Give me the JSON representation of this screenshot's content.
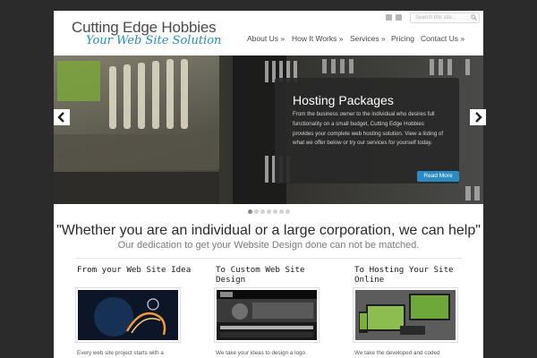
{
  "header": {
    "title": "Cutting Edge Hobbies",
    "tagline": "Your Web Site Solution",
    "search_placeholder": "Search this site...",
    "social_icons": [
      "twitter-icon",
      "rss-icon"
    ]
  },
  "nav": {
    "items": [
      {
        "label": "About Us »"
      },
      {
        "label": "How It Works »"
      },
      {
        "label": "Services »"
      },
      {
        "label": "Pricing"
      },
      {
        "label": "Contact Us »"
      }
    ]
  },
  "slider": {
    "title": "Hosting Packages",
    "text": "From the business owner to the individual who desires full functionality on a small budget, Cutting Edge Hobbies provides your complete web hosting solution. View a listing of what we offer below or try our services for yourself today.",
    "button": "Read More",
    "slide_count": 7,
    "active_slide": 1,
    "accent_color": "#2a8cc2"
  },
  "intro": {
    "headline": "\"Whether you are an individual or a large corporation, we can help\"",
    "subhead": "Our dedication to get your Website Design done can not be matched."
  },
  "columns": [
    {
      "title": "From your Web Site Idea",
      "text": "Every web site project starts with a"
    },
    {
      "title": "To Custom Web Site Design",
      "text": "We take your ideas to design a logo"
    },
    {
      "title": "To Hosting Your Site Online",
      "text": "We take the developed and coded"
    }
  ]
}
